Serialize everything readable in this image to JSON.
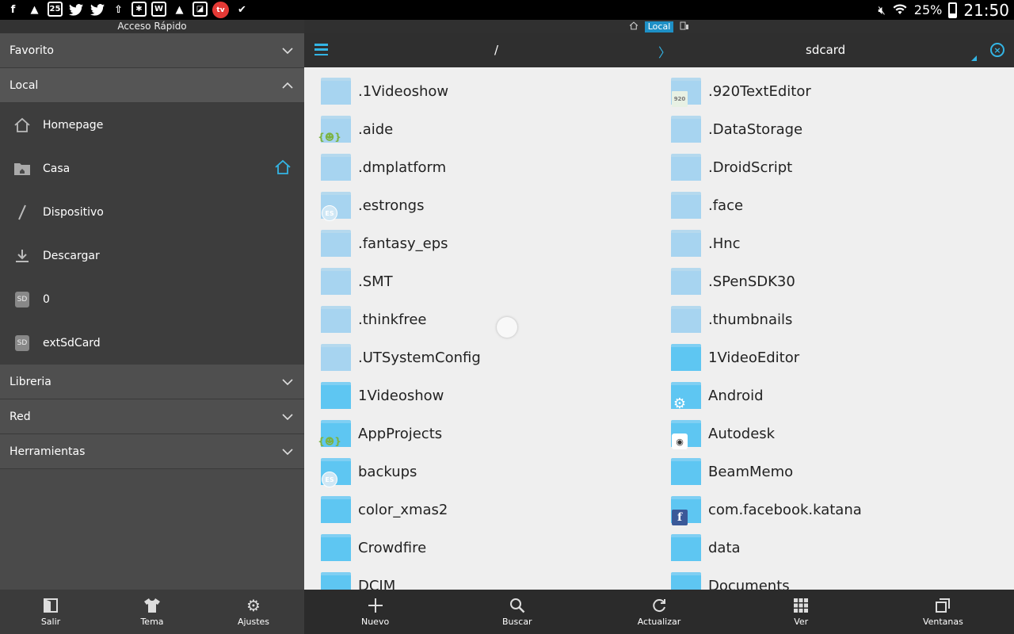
{
  "statusbar": {
    "icons": [
      "facebook-icon",
      "notification-icon",
      "calendar-icon",
      "twitter-icon",
      "twitter-icon",
      "upload-icon",
      "app-icon",
      "wordpress-icon",
      "rocket-icon",
      "gallery-icon",
      "app-red-icon",
      "check-icon"
    ],
    "calendar_day": "25",
    "battery": "25%",
    "time": "21:50"
  },
  "sidebar": {
    "title": "Acceso Rápido",
    "sections": {
      "favorito": "Favorito",
      "local": "Local",
      "libreria": "Libreria",
      "red": "Red",
      "herramientas": "Herramientas"
    },
    "local_items": [
      {
        "label": "Homepage",
        "icon": "home-icon"
      },
      {
        "label": "Casa",
        "icon": "folder-home-icon"
      },
      {
        "label": "Dispositivo",
        "icon": "slash-icon"
      },
      {
        "label": "Descargar",
        "icon": "download-icon"
      },
      {
        "label": "0",
        "icon": "sd-card-icon"
      },
      {
        "label": "extSdCard",
        "icon": "sd-card-icon"
      }
    ],
    "sd_label": "SD"
  },
  "topinfo": {
    "window_label": "Local"
  },
  "pathbar": {
    "root": "/",
    "separator": "〉",
    "current": "sdcard"
  },
  "files": [
    {
      "name": ".1Videoshow",
      "style": "light",
      "badge": ""
    },
    {
      "name": ".920TextEditor",
      "style": "light",
      "badge": "doc"
    },
    {
      "name": ".aide",
      "style": "light",
      "badge": "android"
    },
    {
      "name": ".DataStorage",
      "style": "light",
      "badge": ""
    },
    {
      "name": ".dmplatform",
      "style": "light",
      "badge": ""
    },
    {
      "name": ".DroidScript",
      "style": "light",
      "badge": ""
    },
    {
      "name": ".estrongs",
      "style": "light",
      "badge": "es"
    },
    {
      "name": ".face",
      "style": "light",
      "badge": ""
    },
    {
      "name": ".fantasy_eps",
      "style": "light",
      "badge": ""
    },
    {
      "name": ".Hnc",
      "style": "light",
      "badge": ""
    },
    {
      "name": ".SMT",
      "style": "light",
      "badge": ""
    },
    {
      "name": ".SPenSDK30",
      "style": "light",
      "badge": ""
    },
    {
      "name": ".thinkfree",
      "style": "light",
      "badge": ""
    },
    {
      "name": ".thumbnails",
      "style": "light",
      "badge": ""
    },
    {
      "name": ".UTSystemConfig",
      "style": "light",
      "badge": ""
    },
    {
      "name": "1VideoEditor",
      "style": "dark",
      "badge": ""
    },
    {
      "name": "1Videoshow",
      "style": "dark",
      "badge": ""
    },
    {
      "name": "Android",
      "style": "dark",
      "badge": "gear"
    },
    {
      "name": "AppProjects",
      "style": "dark",
      "badge": "android"
    },
    {
      "name": "Autodesk",
      "style": "dark",
      "badge": "cam"
    },
    {
      "name": "backups",
      "style": "dark",
      "badge": "es"
    },
    {
      "name": "BeamMemo",
      "style": "dark",
      "badge": ""
    },
    {
      "name": "color_xmas2",
      "style": "dark",
      "badge": ""
    },
    {
      "name": "com.facebook.katana",
      "style": "dark",
      "badge": "fb"
    },
    {
      "name": "Crowdfire",
      "style": "dark",
      "badge": ""
    },
    {
      "name": "data",
      "style": "dark",
      "badge": ""
    },
    {
      "name": "DCIM",
      "style": "dark",
      "badge": ""
    },
    {
      "name": "Documents",
      "style": "dark",
      "badge": ""
    }
  ],
  "bottom_left": [
    {
      "label": "Salir",
      "icon": "exit-icon"
    },
    {
      "label": "Tema",
      "icon": "tshirt-icon"
    },
    {
      "label": "Ajustes",
      "icon": "gear-icon"
    }
  ],
  "bottom_right": [
    {
      "label": "Nuevo",
      "icon": "plus-icon"
    },
    {
      "label": "Buscar",
      "icon": "search-icon"
    },
    {
      "label": "Actualizar",
      "icon": "refresh-icon"
    },
    {
      "label": "Ver",
      "icon": "grid-icon"
    },
    {
      "label": "Ventanas",
      "icon": "windows-icon"
    }
  ],
  "colors": {
    "accent": "#33b5e5",
    "folder_light": "#a7d4f0",
    "folder_dark": "#5ec6f2",
    "sidebar_bg": "#4a4a4a",
    "list_bg": "#efefef"
  }
}
